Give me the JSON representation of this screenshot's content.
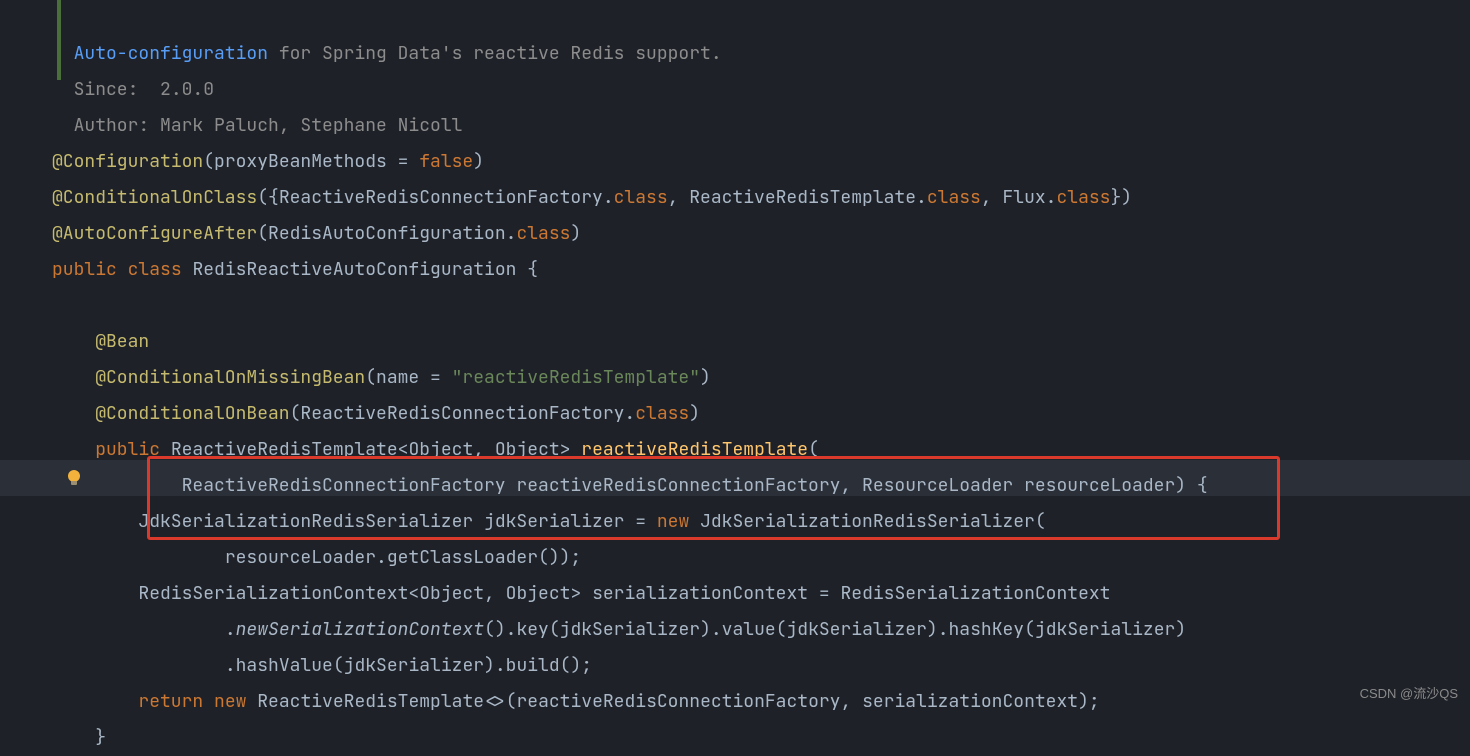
{
  "doc": {
    "link": "Auto-configuration",
    "desc": " for Spring Data's reactive Redis support.",
    "since_lbl": "Since:",
    "since_val": "2.0.0",
    "author_lbl": "Author:",
    "author_val": "Mark Paluch, Stephane Nicoll"
  },
  "code": {
    "anno_Configuration": "@Configuration",
    "proxyBeanMethods": "proxyBeanMethods",
    "eq": " = ",
    "false": "false",
    "anno_ConditionalOnClass": "@ConditionalOnClass",
    "ReactiveRedisConnectionFactory": "ReactiveRedisConnectionFactory",
    "class": "class",
    "ReactiveRedisTemplate": "ReactiveRedisTemplate",
    "Flux": "Flux",
    "anno_AutoConfigureAfter": "@AutoConfigureAfter",
    "RedisAutoConfiguration": "RedisAutoConfiguration",
    "public": "public",
    "classkw": "class",
    "RedisReactiveAutoConfiguration": "RedisReactiveAutoConfiguration",
    "anno_Bean": "@Bean",
    "anno_ConditionalOnMissingBean": "@ConditionalOnMissingBean",
    "name": "name",
    "str_reactiveRedisTemplate": "\"reactiveRedisTemplate\"",
    "anno_ConditionalOnBean": "@ConditionalOnBean",
    "Object": "Object",
    "reactiveRedisTemplate": "reactiveRedisTemplate",
    "reactiveRedisConnectionFactory": "reactiveRedisConnectionFactory",
    "ResourceLoader": "ResourceLoader",
    "resourceLoader": "resourceLoader",
    "JdkSerializationRedisSerializer": "JdkSerializationRedisSerializer",
    "jdkSerializer": "jdkSerializer",
    "new": "new",
    "getClassLoader": "getClassLoader",
    "RedisSerializationContext": "RedisSerializationContext",
    "serializationContext": "serializationContext",
    "newSerializationContext": "newSerializationContext",
    "key": "key",
    "value": "value",
    "hashKey": "hashKey",
    "hashValue": "hashValue",
    "build": "build",
    "return": "return"
  },
  "watermark": "CSDN @流沙QS"
}
